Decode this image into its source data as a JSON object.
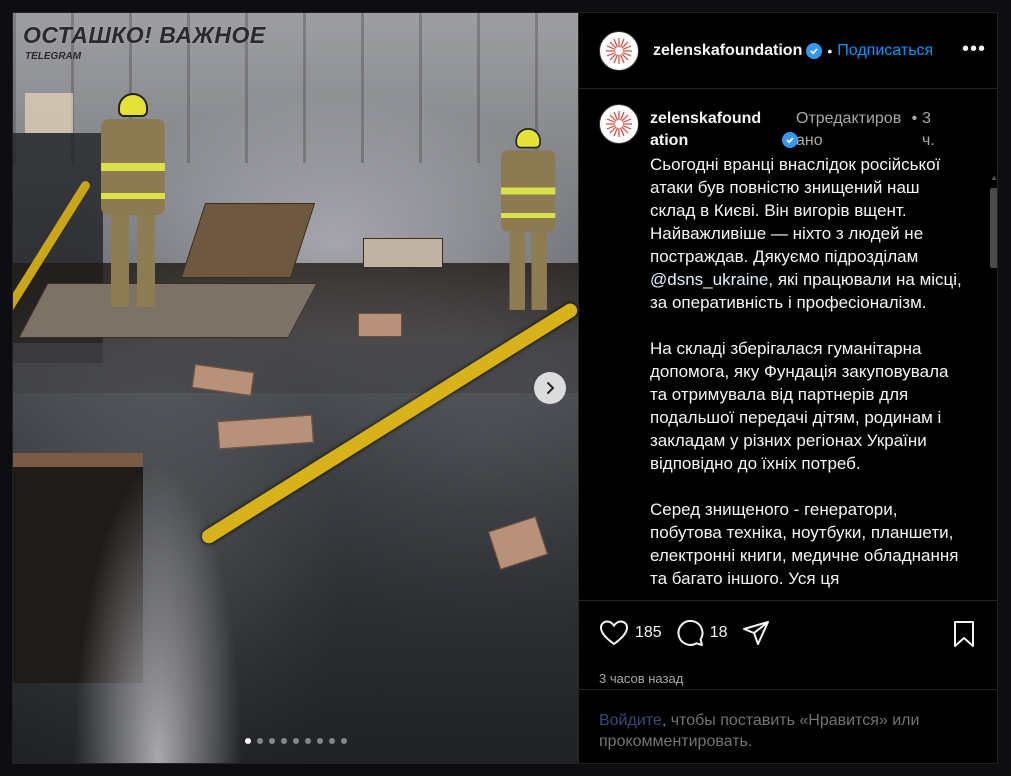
{
  "photo": {
    "watermark_title": "ОСТАШКО! ВАЖНОЕ",
    "watermark_subtitle": "TELEGRAM",
    "carousel": {
      "total": 9,
      "active_index": 0
    }
  },
  "header": {
    "username": "zelenskafoundation",
    "separator": "•",
    "follow_label": "Подписаться",
    "more_label": "•••"
  },
  "caption": {
    "username_line1": "zelenskafound",
    "username_line2": "ation",
    "edited_line1": "Отредактиров",
    "edited_line2": "ано",
    "dot": "•",
    "time_line1": "3",
    "time_line2": "ч.",
    "paragraphs": {
      "p1_before": "Сьогодні вранці внаслідок російської атаки був повністю знищений наш склад в Києві. Він вигорів вщент. Найважливіше — ніхто з людей не постраждав. Дякуємо підрозділам ",
      "p1_mention": "@dsns_ukraine",
      "p1_after": ", які працювали на місці, за оперативність і професіоналізм.",
      "p2": "На складі зберігалася гуманітарна допомога, яку Фундація закуповувала та отримувала від партнерів для подальшої передачі дітям, родинам і закладам у різних регіонах України відповідно до їхніх потреб.",
      "p3": "Серед знищеного - генератори, побутова техніка, ноутбуки, планшети, електронні книги, медичне обладнання та багато іншого. Уся ця"
    }
  },
  "actions": {
    "likes": "185",
    "comments": "18",
    "posted_ago": "3 часов назад"
  },
  "login_prompt": {
    "link_label": "Войдите",
    "rest_text": ", чтобы поставить «Нравится» или прокомментировать."
  },
  "colors": {
    "background": "#000000",
    "accent_blue": "#0095f6",
    "verified_blue": "#3897f0",
    "muted_text": "#a8a8a8"
  },
  "icons": [
    "heart-icon",
    "comment-icon",
    "share-icon",
    "bookmark-icon",
    "verified-icon",
    "chevron-right-icon",
    "more-icon"
  ]
}
